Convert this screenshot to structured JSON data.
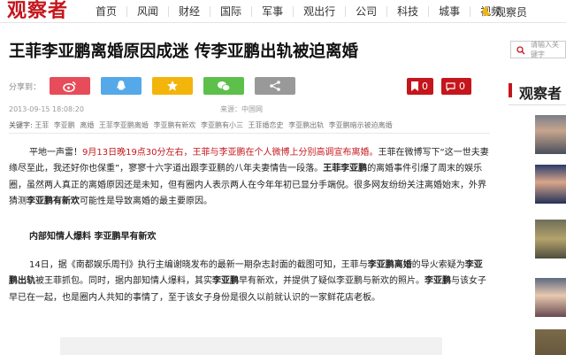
{
  "header": {
    "logo": "观察者",
    "nav": [
      "首页",
      "风闻",
      "财经",
      "国际",
      "军事",
      "观出行",
      "公司",
      "科技",
      "城事",
      "视频"
    ],
    "user_label": "观察员"
  },
  "article": {
    "title": "王菲李亚鹏离婚原因成迷 传李亚鹏出轨被迫离婚",
    "share_label": "分享到：",
    "fav_count": "0",
    "comment_count": "0",
    "date": "2013-09-15 18:08:20",
    "source": "来源：中国网",
    "keywords_label": "关键字:",
    "keywords": [
      "王菲",
      "李亚鹏",
      "离婚",
      "王菲李亚鹏离婚",
      "李亚鹏有新欢",
      "李亚鹏有小三",
      "王菲婚恋史",
      "李亚鹏出轨",
      "李亚鹏暗示被迫离婚"
    ],
    "p1": {
      "lead": "平地一声雷！",
      "red": "9月13日晚19点30分左右，王菲与李亚鹏在个人微博上分别高调宣布离婚。",
      "t1": "王菲在微博写下“这一世夫妻缘尽至此，我还好你也保重”，寥寥十六字道出跟李亚鹏的八年夫妻情告一段落。",
      "t2": "王菲李亚鹏",
      "t3": "的离婚事件引爆了周末的娱乐圈，虽然两人真正的离婚原因还是未知，但有圈内人表示两人在今年年初已显分手端倪。很多网友纷纷关注离婚始末，外界猜测",
      "t4": "李亚鹏有新欢",
      "t5": "可能性是导致离婚的最主要原因。"
    },
    "subhead": "内部知情人爆料 李亚鹏早有新欢",
    "p3": {
      "s1": "14日，据《南都娱乐周刊》执行主编谢晓发布的最新一期杂志封面的截图可知，王菲与",
      "b1": "李亚鹏离婚",
      "s2": "的导火索疑为",
      "b2": "李亚鹏出轨",
      "s3": "被王菲抓包。同时，据内部知情人爆料，其实",
      "b3": "李亚鹏",
      "s4": "早有新欢，并提供了疑似李亚鹏与新欢的照片。",
      "b4": "李亚鹏",
      "s5": "与该女子早已在一起，也是圈内人共知的事情了，至于该女子身份是很久以前就认识的一家鲜花店老板。"
    }
  },
  "sidebar": {
    "search_placeholder": "请输入关键字",
    "section_title": "观察者"
  }
}
